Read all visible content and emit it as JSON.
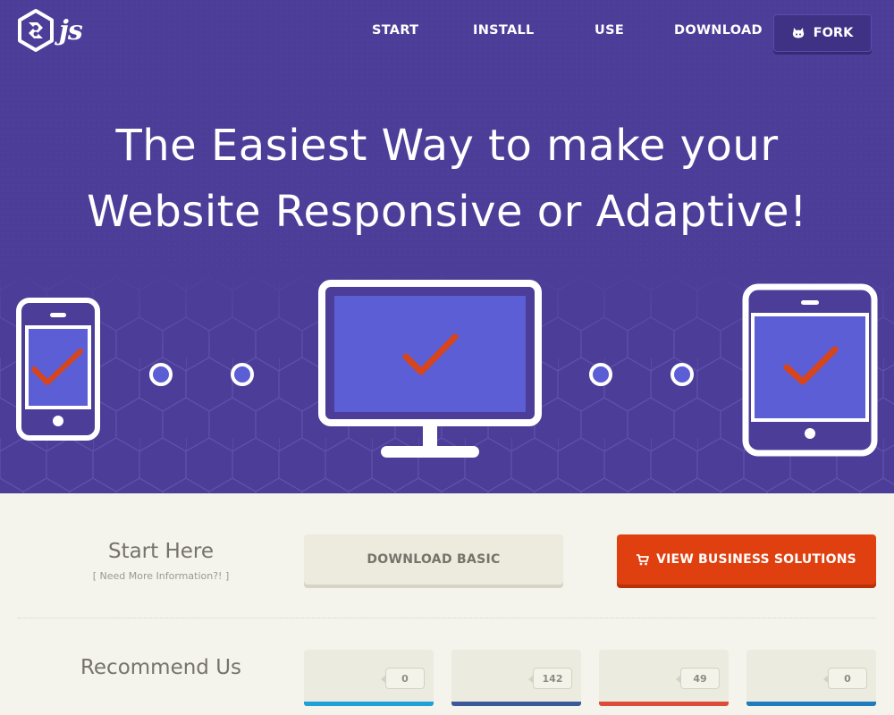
{
  "nav": {
    "logo_text": "js",
    "links": [
      "START",
      "INSTALL",
      "USE",
      "DOWNLOAD"
    ],
    "fork_label": "FORK",
    "fork_icon": "github-octocat-icon"
  },
  "hero": {
    "headline_line1": "The Easiest Way to make your",
    "headline_line2": "Website Responsive or Adaptive!",
    "colors": {
      "background": "#4c3d98",
      "screen": "#5b5ed4",
      "check": "#d9451b"
    },
    "devices": [
      "phone-icon",
      "desktop-monitor-icon",
      "tablet-icon"
    ]
  },
  "start": {
    "title": "Start Here",
    "subtitle": "[ Need More Information?! ]",
    "download_basic_label": "DOWNLOAD BASIC",
    "business_label": "VIEW BUSINESS SOLUTIONS",
    "business_icon": "cart-icon"
  },
  "recommend": {
    "title": "Recommend Us",
    "shares": [
      {
        "count": "0",
        "color": "#1ea1d8"
      },
      {
        "count": "142",
        "color": "#3b5998"
      },
      {
        "count": "49",
        "color": "#dd4b39"
      },
      {
        "count": "0",
        "color": "#1f7bbf"
      }
    ]
  },
  "colors": {
    "accent": "#e0400f",
    "page_background": "#f4f3ec"
  }
}
